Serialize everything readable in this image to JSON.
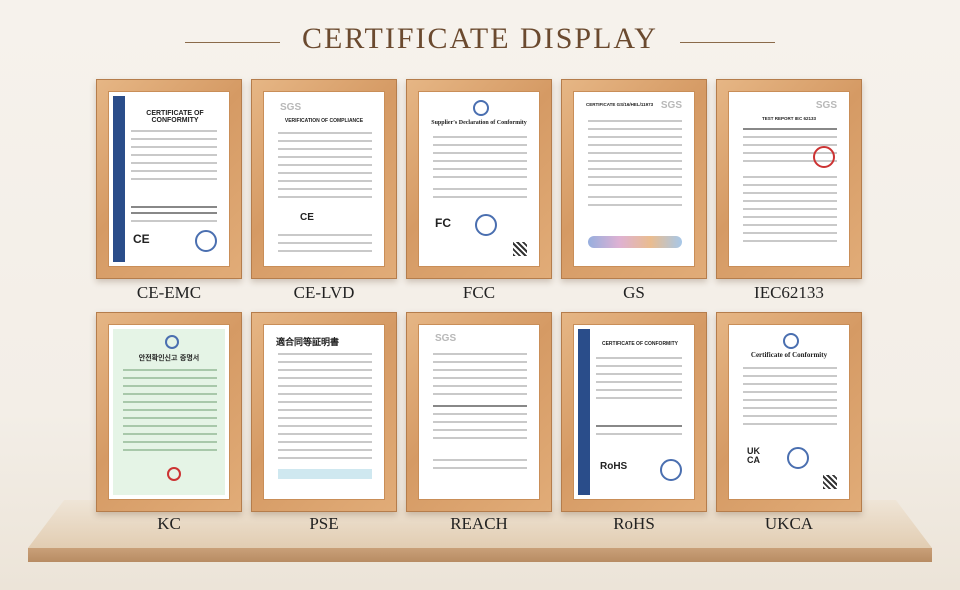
{
  "header": {
    "title": "CERTIFICATE DISPLAY"
  },
  "certificates": [
    {
      "label": "CE-EMC",
      "doc_title": "CERTIFICATE OF CONFORMITY"
    },
    {
      "label": "CE-LVD",
      "doc_title": "VERIFICATION OF COMPLIANCE"
    },
    {
      "label": "FCC",
      "doc_title": "Supplier's Declaration of Conformity"
    },
    {
      "label": "GS",
      "doc_title": "CERTIFICATE GS/16/HEL/11973"
    },
    {
      "label": "IEC62133",
      "doc_title": "TEST REPORT IEC 62133"
    },
    {
      "label": "KC",
      "doc_title": "안전확인신고 증명서"
    },
    {
      "label": "PSE",
      "doc_title": "適合同等証明書"
    },
    {
      "label": "REACH",
      "doc_title": "SGS"
    },
    {
      "label": "RoHS",
      "doc_title": "CERTIFICATE OF CONFORMITY"
    },
    {
      "label": "UKCA",
      "doc_title": "Certificate of Conformity"
    }
  ],
  "marks": {
    "ce": "CE",
    "fcc": "FC",
    "rohs": "RoHS",
    "ukca": "UK CA",
    "sgs": "SGS"
  },
  "colors": {
    "frame": "#d59a64",
    "title": "#6b4a2f",
    "sidebar": "#2a4d8a"
  }
}
